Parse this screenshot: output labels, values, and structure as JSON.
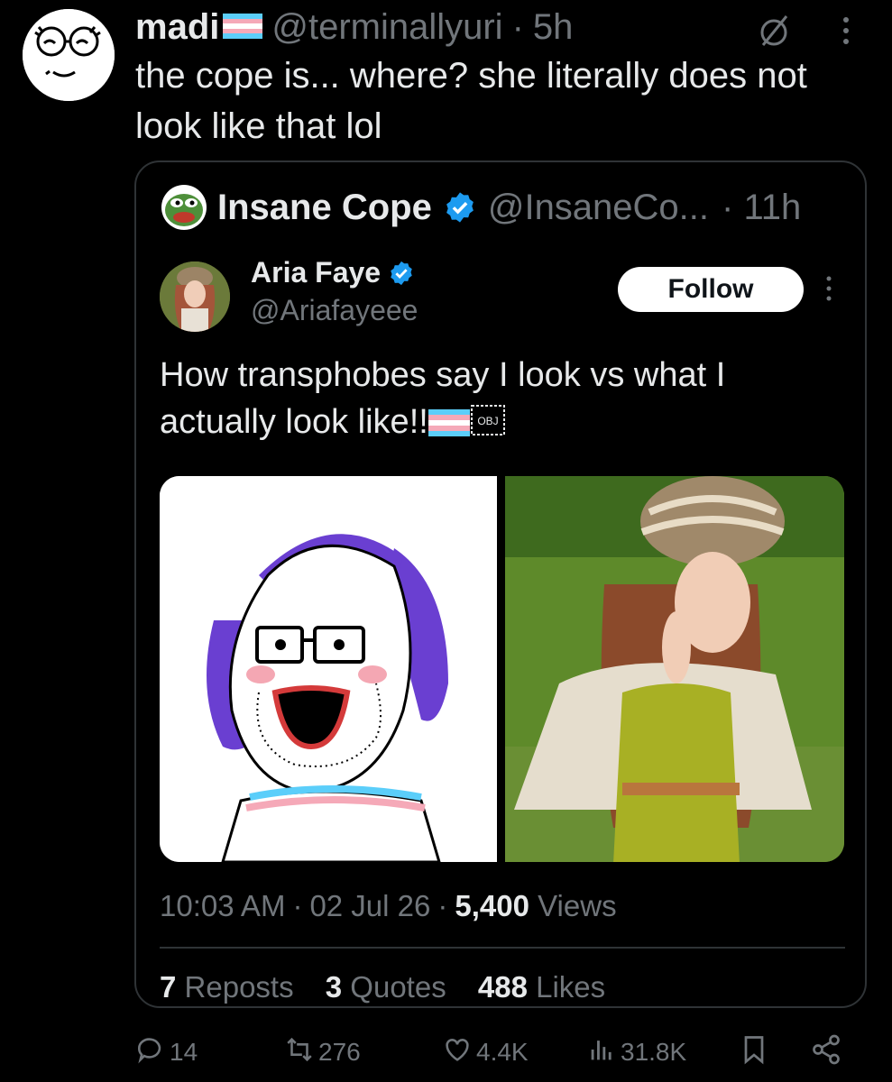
{
  "post": {
    "author_name": "madi",
    "author_handle": "@terminallyuri",
    "separator": "·",
    "time": "5h",
    "text": "the cope is... where? she literally does not look like that lol"
  },
  "quote": {
    "author_name": "Insane Cope",
    "author_handle": "@InsaneCo...",
    "time": "· 11h",
    "embedded": {
      "author_name": "Aria Faye",
      "author_handle": "@Ariafayeee",
      "follow_label": "Follow",
      "text": "How transphobes say I look vs what I actually look like!!",
      "obj_badge": "OBJ",
      "timestamp": "10:03 AM",
      "date": "02 Jul 26",
      "views_count": "5,400",
      "views_label": "Views",
      "reposts_count": "7",
      "reposts_label": "Reposts",
      "quotes_count": "3",
      "quotes_label": "Quotes",
      "likes_count": "488",
      "likes_label": "Likes"
    }
  },
  "actions": {
    "replies": "14",
    "reposts": "276",
    "likes": "4.4K",
    "views": "31.8K"
  },
  "icons": {
    "hide": "hide-eye-off-icon",
    "more": "more-vertical-icon",
    "verified": "verified-badge-icon",
    "reply": "reply-icon",
    "repost": "repost-icon",
    "like": "heart-icon",
    "views": "views-bar-icon",
    "bookmark": "bookmark-icon",
    "share": "share-icon"
  },
  "colors": {
    "background": "#000000",
    "text_primary": "#e7e9ea",
    "text_secondary": "#71767b",
    "verified_blue": "#1d9bf0",
    "border": "#2f3336",
    "flag_blue": "#5bcefa",
    "flag_pink": "#f5a9b8"
  }
}
